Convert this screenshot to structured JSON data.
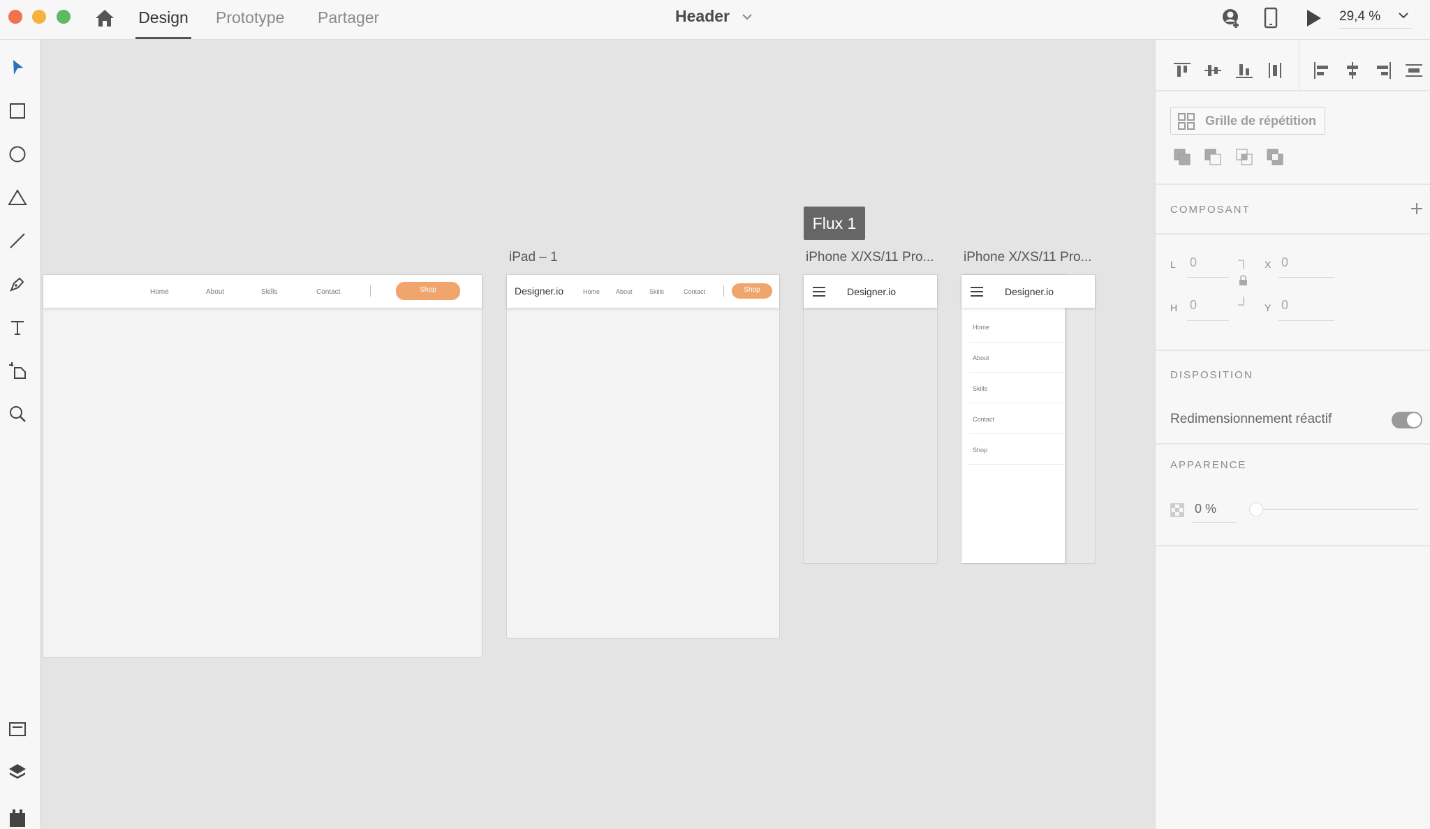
{
  "window": {
    "colors": {
      "close": "#f2714e",
      "minimize": "#f6b13e",
      "maximize": "#5dba60"
    }
  },
  "topbar": {
    "tabs": [
      {
        "label": "Design",
        "active": true
      },
      {
        "label": "Prototype",
        "active": false
      },
      {
        "label": "Partager",
        "active": false
      }
    ],
    "document_title": "Header",
    "zoom": "29,4 %",
    "icons": [
      "home-icon",
      "chevron-down-icon",
      "user-share-icon",
      "mobile-preview-icon",
      "play-icon"
    ]
  },
  "toolbar": {
    "tools": [
      "select-icon",
      "rectangle-icon",
      "ellipse-icon",
      "triangle-icon",
      "line-icon",
      "pen-icon",
      "text-icon",
      "artboard-icon",
      "zoom-icon"
    ],
    "bottom": [
      "assets-icon",
      "layers-icon",
      "plugins-icon"
    ]
  },
  "canvas": {
    "flow_badge": "Flux 1",
    "artboards": {
      "desktop": {
        "nav": [
          "Home",
          "About",
          "Skills",
          "Contact"
        ],
        "button": "Shop"
      },
      "ipad": {
        "label": "iPad – 1",
        "brand": "Designer.io",
        "nav": [
          "Home",
          "About",
          "Skills",
          "Contact"
        ],
        "button": "Shop"
      },
      "iphone1": {
        "label": "iPhone X/XS/11 Pro...",
        "brand": "Designer.io"
      },
      "iphone2": {
        "label": "iPhone X/XS/11 Pro...",
        "brand": "Designer.io",
        "menu": [
          "Home",
          "About",
          "Skills",
          "Contact",
          "Shop"
        ]
      }
    },
    "accent": "#f0a56c"
  },
  "panel": {
    "repeat_grid": "Grille de répétition",
    "component": {
      "title": "COMPOSANT"
    },
    "transform": {
      "w_label": "L",
      "w_value": "0",
      "h_label": "H",
      "h_value": "0",
      "x_label": "X",
      "x_value": "0",
      "y_label": "Y",
      "y_value": "0"
    },
    "layout": {
      "title": "DISPOSITION",
      "responsive": "Redimensionnement réactif",
      "responsive_on": true
    },
    "appearance": {
      "title": "APPARENCE",
      "opacity": "0 %"
    }
  }
}
